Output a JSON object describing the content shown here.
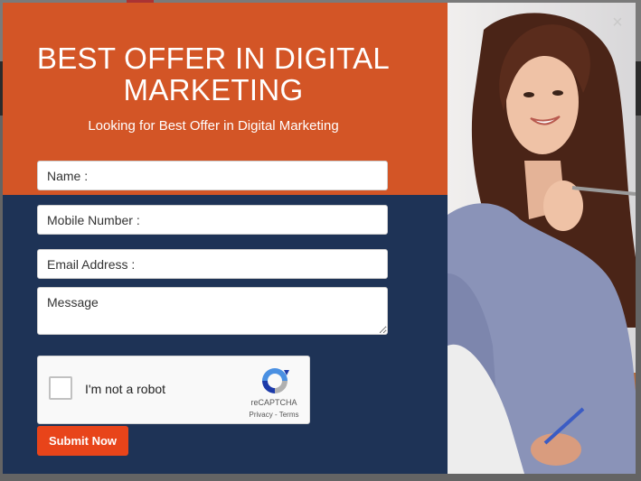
{
  "popup": {
    "headline_line1": "BEST OFFER IN DIGITAL",
    "headline_line2": "MARKETING",
    "subheadline": "Looking for Best Offer in Digital Marketing",
    "close_icon": "close-icon"
  },
  "form": {
    "name_placeholder": "Name :",
    "mobile_placeholder": "Mobile Number :",
    "email_placeholder": "Email Address :",
    "message_placeholder": "Message",
    "submit_label": "Submit Now"
  },
  "recaptcha": {
    "label": "I'm not a robot",
    "brand": "reCAPTCHA",
    "privacy": "Privacy",
    "separator": " - ",
    "terms": "Terms"
  },
  "colors": {
    "header_orange": "#d35526",
    "form_navy": "#1e3356",
    "submit_red": "#e8441a"
  }
}
